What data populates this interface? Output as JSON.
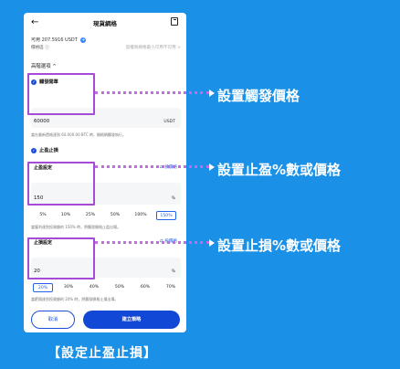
{
  "header": {
    "title": "現貨網格"
  },
  "balance": {
    "label": "可用 207.5916 USDT",
    "plus": "+"
  },
  "grid_type": {
    "label": "價格區 ⓘ",
    "right_text": "當權限網格最小可用不可用 >"
  },
  "advanced": {
    "label": "高階選項 ^"
  },
  "trigger": {
    "check_label": "觸發開單",
    "value": "60000",
    "unit": "USDT",
    "hint": "當在最新價格達到 60,000.00 BTC 時，開格網觸發執行。"
  },
  "tp_sl": {
    "check_label": "止盈止損"
  },
  "take_profit": {
    "label": "止盈設定",
    "link": "⇄ 按價格",
    "value": "150",
    "unit": "%",
    "percent_options": [
      "5%",
      "10%",
      "25%",
      "50%",
      "100%",
      "150%"
    ],
    "selected": "150%",
    "hint": "當獲利達到投資額的 150% 時，將觸發開格止盈出場。"
  },
  "stop_loss": {
    "label": "止損設定",
    "link": "⇄ 按價格",
    "value": "20",
    "unit": "%",
    "percent_options": [
      "20%",
      "30%",
      "40%",
      "50%",
      "60%",
      "70%"
    ],
    "selected": "20%",
    "hint": "當虧損達到投資額的 20% 時，將觸發開格止損出場。"
  },
  "buttons": {
    "cancel": "取消",
    "create": "建立策略"
  },
  "callouts": {
    "trigger": "設置觸發價格",
    "take_profit": "設置止盈%數或價格",
    "stop_loss": "設置止損%數或價格"
  },
  "caption": "【設定止盈止損】",
  "colors": {
    "background": "#1b90e7",
    "highlight": "#a64bd8",
    "primary": "#1248d6"
  }
}
